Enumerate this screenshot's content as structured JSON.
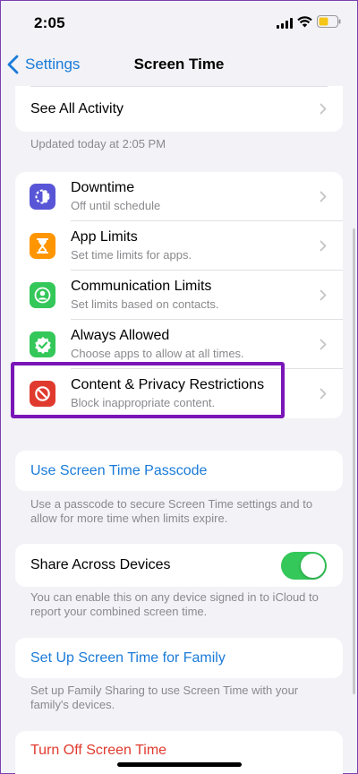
{
  "status_bar": {
    "time": "2:05"
  },
  "nav": {
    "back_label": "Settings",
    "title": "Screen Time"
  },
  "activity": {
    "see_all_label": "See All Activity",
    "updated_text": "Updated today at 2:05 PM"
  },
  "limits": [
    {
      "title": "Downtime",
      "subtitle": "Off until schedule",
      "icon": "downtime-icon",
      "color": "#5856d6"
    },
    {
      "title": "App Limits",
      "subtitle": "Set time limits for apps.",
      "icon": "hourglass-icon",
      "color": "#ff9500"
    },
    {
      "title": "Communication Limits",
      "subtitle": "Set limits based on contacts.",
      "icon": "contact-icon",
      "color": "#34c759"
    },
    {
      "title": "Always Allowed",
      "subtitle": "Choose apps to allow at all times.",
      "icon": "checkmark-badge-icon",
      "color": "#34c759"
    },
    {
      "title": "Content & Privacy Restrictions",
      "subtitle": "Block inappropriate content.",
      "icon": "restriction-icon",
      "color": "#e03a2e"
    }
  ],
  "passcode": {
    "label": "Use Screen Time Passcode",
    "footnote": "Use a passcode to secure Screen Time settings and to allow for more time when limits expire."
  },
  "share": {
    "label": "Share Across Devices",
    "toggle_on": true,
    "footnote": "You can enable this on any device signed in to iCloud to report your combined screen time."
  },
  "family": {
    "label": "Set Up Screen Time for Family",
    "footnote": "Set up Family Sharing to use Screen Time with your family's devices."
  },
  "turn_off": {
    "label": "Turn Off Screen Time"
  },
  "colors": {
    "accent": "#1a7bd8",
    "destructive": "#e03a2e",
    "highlight": "#7a16b8",
    "toggle_on": "#34c759"
  }
}
